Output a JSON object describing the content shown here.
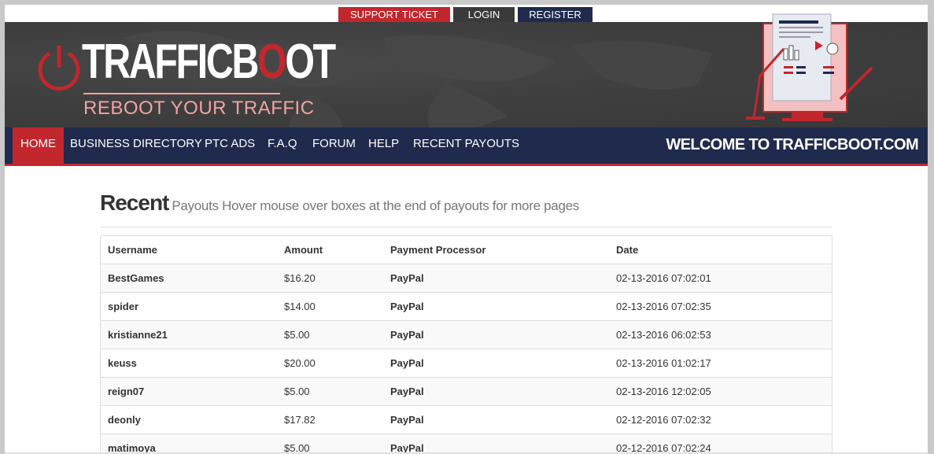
{
  "topbar": {
    "support_label": "SUPPORT TICKET",
    "login_label": "LOGIN",
    "register_label": "REGISTER"
  },
  "brand": {
    "logo_text_white": "TRAFFICB",
    "logo_text_red": "O",
    "logo_text_end": "OT",
    "tagline": "REBOOT YOUR TRAFFIC",
    "accent_color": "#c1272d",
    "nav_color": "#1f2a4d"
  },
  "nav": {
    "items": [
      {
        "label": "HOME",
        "active": true
      },
      {
        "label": "BUSINESS DIRECTORY"
      },
      {
        "label": "PTC ADS"
      },
      {
        "label": "F.A.Q"
      },
      {
        "label": "FORUM"
      },
      {
        "label": "HELP"
      },
      {
        "label": "RECENT PAYOUTS"
      }
    ],
    "welcome": "WELCOME TO TRAFFICBOOT.COM"
  },
  "main": {
    "heading_big": "Recent",
    "heading_small": "Payouts Hover mouse over boxes at the end of payouts for more pages",
    "table": {
      "columns": [
        "Username",
        "Amount",
        "Payment Processor",
        "Date"
      ],
      "rows": [
        [
          "BestGames",
          "$16.20",
          "PayPal",
          "02-13-2016 07:02:01"
        ],
        [
          "spider",
          "$14.00",
          "PayPal",
          "02-13-2016 07:02:35"
        ],
        [
          "kristianne21",
          "$5.00",
          "PayPal",
          "02-13-2016 06:02:53"
        ],
        [
          "keuss",
          "$20.00",
          "PayPal",
          "02-13-2016 01:02:17"
        ],
        [
          "reign07",
          "$5.00",
          "PayPal",
          "02-13-2016 12:02:05"
        ],
        [
          "deonly",
          "$17.82",
          "PayPal",
          "02-12-2016 07:02:32"
        ],
        [
          "matimoya",
          "$5.00",
          "PayPal",
          "02-12-2016 07:02:24"
        ]
      ]
    }
  }
}
